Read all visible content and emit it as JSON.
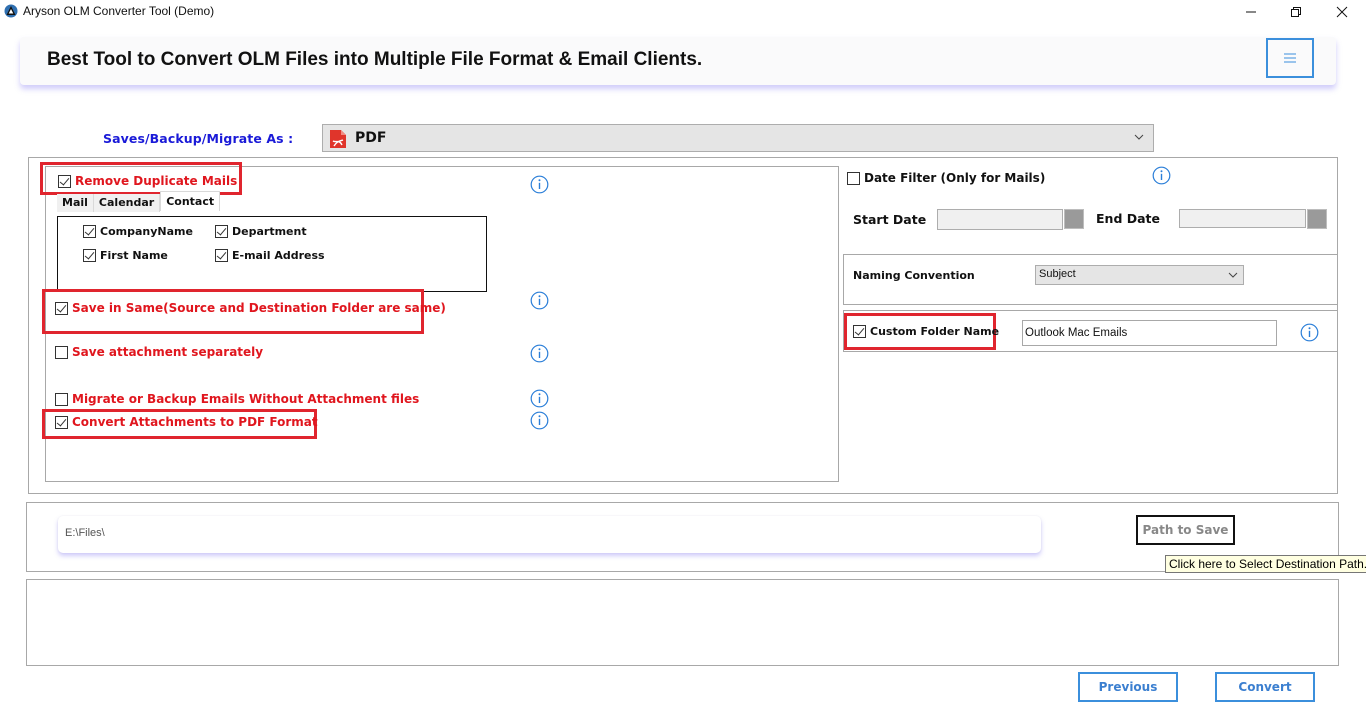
{
  "window": {
    "title": "Aryson OLM Converter Tool (Demo)",
    "controls": [
      "minimize",
      "restore",
      "close"
    ]
  },
  "header": {
    "title": "Best Tool to Convert OLM Files into Multiple File Format & Email Clients.",
    "menu_icon": "hamburger-menu-icon"
  },
  "saves_as": {
    "label": "Saves/Backup/Migrate As :",
    "selected": "PDF",
    "icon": "pdf-file-icon"
  },
  "left_options": {
    "remove_duplicates": {
      "label": "Remove Duplicate Mails",
      "checked": true,
      "highlighted": true
    },
    "tabs": [
      {
        "label": "Mail",
        "active": false
      },
      {
        "label": "Calendar",
        "active": false
      },
      {
        "label": "Contact",
        "active": true
      }
    ],
    "contact_fields": [
      {
        "label": "CompanyName",
        "checked": true
      },
      {
        "label": "Department",
        "checked": true
      },
      {
        "label": "First Name",
        "checked": true
      },
      {
        "label": "E-mail Address",
        "checked": true
      }
    ],
    "save_in_same": {
      "label": "Save in Same(Source and Destination Folder are same)",
      "checked": true,
      "highlighted": true
    },
    "save_attachment": {
      "label": "Save attachment separately",
      "checked": false
    },
    "without_attachment": {
      "label": "Migrate or Backup Emails Without Attachment files",
      "checked": false
    },
    "convert_attachments": {
      "label": "Convert Attachments to PDF Format",
      "checked": true,
      "highlighted": true
    }
  },
  "right_options": {
    "date_filter": {
      "label": "Date Filter  (Only for Mails)",
      "checked": false
    },
    "start_date": {
      "label": "Start Date",
      "value": ""
    },
    "end_date": {
      "label": "End Date",
      "value": ""
    },
    "naming_convention": {
      "label": "Naming Convention",
      "selected": "Subject"
    },
    "custom_folder": {
      "label": "Custom Folder Name",
      "checked": true,
      "highlighted": true,
      "value": "Outlook Mac Emails"
    }
  },
  "destination": {
    "path": "E:\\Files\\",
    "button_label": "Path to Save",
    "tooltip": "Click here to Select Destination Path."
  },
  "footer": {
    "previous_label": "Previous",
    "convert_label": "Convert"
  },
  "colors": {
    "accent_blue": "#3b8fdc",
    "option_red": "#e0161e",
    "highlight_red": "#e0252e",
    "label_blue": "#1a1ad8"
  }
}
